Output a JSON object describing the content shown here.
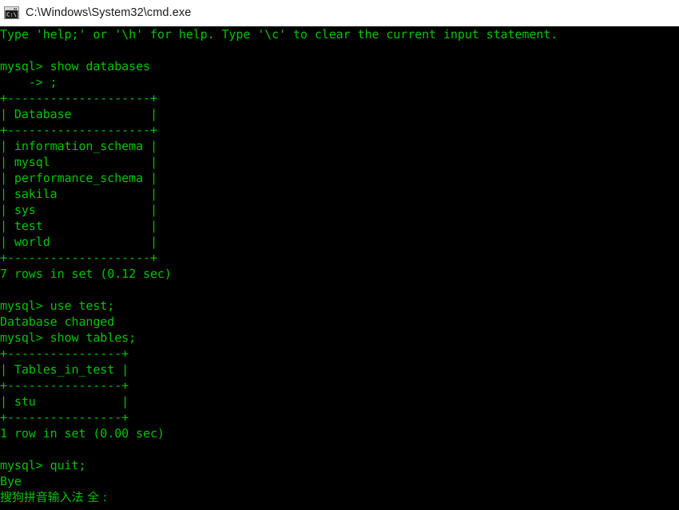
{
  "window": {
    "title": "C:\\Windows\\System32\\cmd.exe",
    "icon": "cmd-console-icon",
    "titlebar_bg": "#ffffff",
    "titlebar_fg": "#1a1a1a",
    "console_bg": "#000000",
    "console_fg": "#00c400"
  },
  "console": {
    "lines": [
      "Type 'help;' or '\\h' for help. Type '\\c' to clear the current input statement.",
      "",
      "mysql> show databases",
      "    -> ;",
      "+--------------------+",
      "| Database           |",
      "+--------------------+",
      "| information_schema |",
      "| mysql              |",
      "| performance_schema |",
      "| sakila             |",
      "| sys                |",
      "| test               |",
      "| world              |",
      "+--------------------+",
      "7 rows in set (0.12 sec)",
      "",
      "mysql> use test;",
      "Database changed",
      "mysql> show tables;",
      "+----------------+",
      "| Tables_in_test |",
      "+----------------+",
      "| stu            |",
      "+----------------+",
      "1 row in set (0.00 sec)",
      "",
      "mysql> quit;",
      "Bye"
    ],
    "ime_status": "搜狗拼音输入法 全 :"
  },
  "session": {
    "help_hint": "Type 'help;' or '\\h' for help. Type '\\c' to clear the current input statement.",
    "prompt": "mysql>",
    "continuation_prompt": "    ->",
    "commands": [
      "show databases",
      ";",
      "use test;",
      "show tables;",
      "quit;"
    ],
    "databases_header": "Database",
    "databases": [
      "information_schema",
      "mysql",
      "performance_schema",
      "sakila",
      "sys",
      "test",
      "world"
    ],
    "databases_result": "7 rows in set (0.12 sec)",
    "use_result": "Database changed",
    "tables_header": "Tables_in_test",
    "tables": [
      "stu"
    ],
    "tables_result": "1 row in set (0.00 sec)",
    "quit_result": "Bye"
  }
}
